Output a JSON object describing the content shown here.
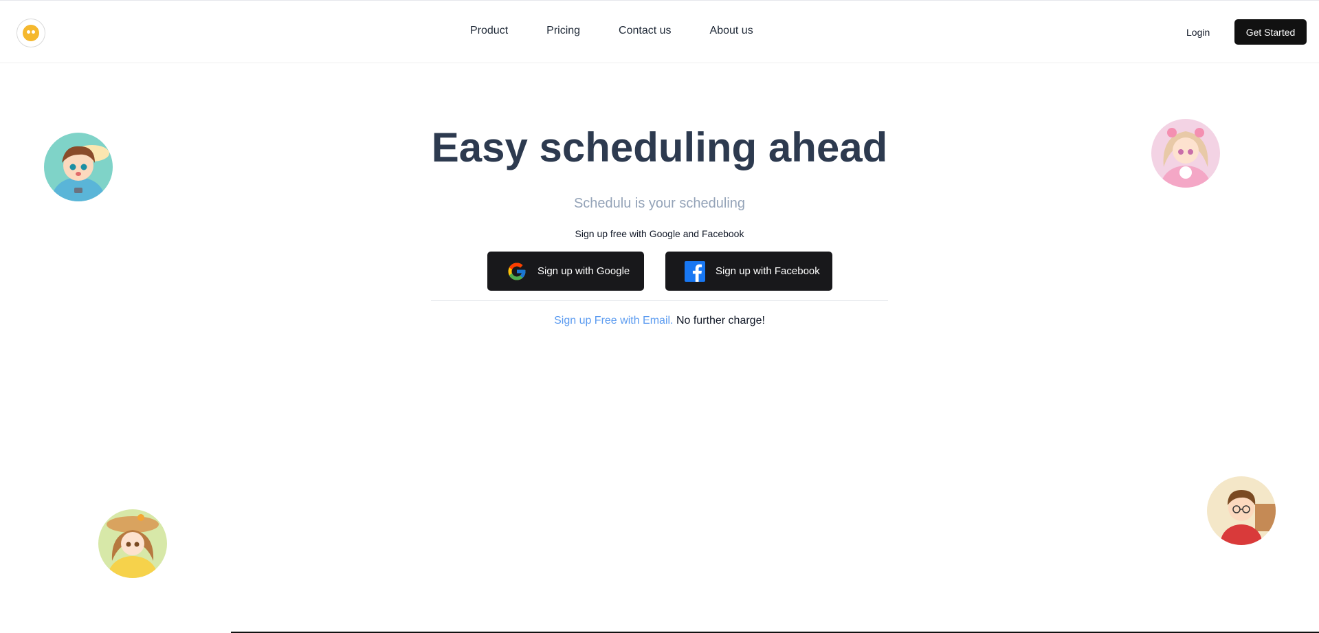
{
  "header": {
    "logo_alt": "Schedulu",
    "nav": [
      {
        "label": "Product"
      },
      {
        "label": "Pricing"
      },
      {
        "label": "Contact us"
      },
      {
        "label": "About us"
      }
    ],
    "login_label": "Login",
    "get_started_label": "Get Started"
  },
  "hero": {
    "title": "Easy scheduling ahead",
    "subtitle": "Schedulu is your scheduling",
    "note": "Sign up free with Google and Facebook",
    "google_button": "Sign up with Google",
    "facebook_button": "Sign up with Facebook",
    "email_link": "Sign up Free with Email.",
    "email_tail": "No further charge!"
  },
  "colors": {
    "title": "#2d3a4f",
    "subtitle": "#94a3b8",
    "button_dark": "#18181b",
    "link": "#5b9bf0"
  },
  "icons": {
    "google": "google-icon",
    "facebook": "facebook-icon"
  }
}
